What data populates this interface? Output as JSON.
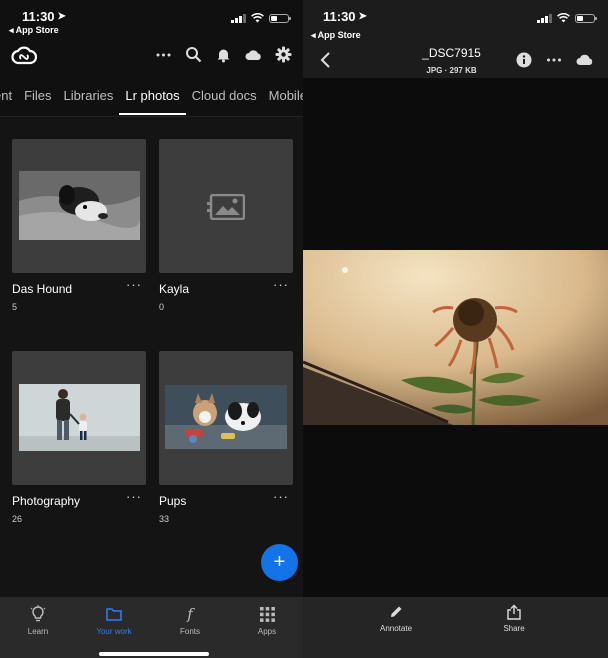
{
  "left": {
    "status": {
      "time": "11:30",
      "back_app": "◂ App Store"
    },
    "header": {
      "logo": "creative-cloud-logo",
      "icons": [
        "more-icon",
        "search-icon",
        "bell-icon",
        "cloud-icon",
        "gear-icon"
      ]
    },
    "tabs": [
      {
        "label": "ent"
      },
      {
        "label": "Files"
      },
      {
        "label": "Libraries"
      },
      {
        "label": "Lr photos",
        "active": true
      },
      {
        "label": "Cloud docs"
      },
      {
        "label": "Mobile"
      }
    ],
    "albums": [
      {
        "name": "Das Hound",
        "count": "5",
        "more": "···"
      },
      {
        "name": "Kayla",
        "count": "0",
        "more": "···"
      },
      {
        "name": "Photography",
        "count": "26",
        "more": "···"
      },
      {
        "name": "Pups",
        "count": "33",
        "more": "···"
      }
    ],
    "fab": "+",
    "tabbar": [
      {
        "label": "Learn",
        "icon": "lightbulb-icon"
      },
      {
        "label": "Your work",
        "icon": "folder-icon",
        "active": true
      },
      {
        "label": "Fonts",
        "icon": "font-icon"
      },
      {
        "label": "Apps",
        "icon": "grid-icon"
      }
    ]
  },
  "right": {
    "status": {
      "time": "11:30",
      "back_app": "◂ App Store"
    },
    "title": "_DSC7915",
    "subtitle": "JPG · 297 KB",
    "actions": [
      {
        "label": "Annotate",
        "icon": "pencil-icon"
      },
      {
        "label": "Share",
        "icon": "share-icon"
      }
    ]
  },
  "colors": {
    "accent": "#1473e6",
    "active_tab": "#2d7ff9"
  }
}
